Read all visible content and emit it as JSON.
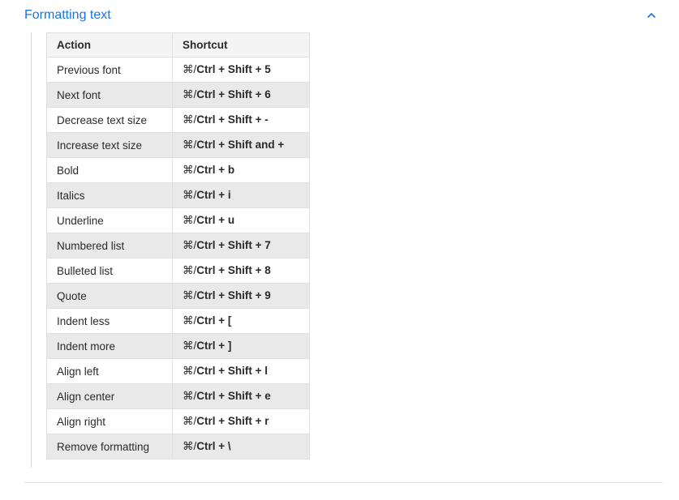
{
  "section": {
    "title": "Formatting text",
    "expanded": true
  },
  "table": {
    "headers": {
      "action": "Action",
      "shortcut": "Shortcut"
    },
    "shortcut_prefix": "⌘/",
    "rows": [
      {
        "action": "Previous font",
        "shortcut_bold": "Ctrl + Shift + 5"
      },
      {
        "action": "Next font",
        "shortcut_bold": "Ctrl + Shift + 6"
      },
      {
        "action": "Decrease text size",
        "shortcut_bold": "Ctrl + Shift + -"
      },
      {
        "action": "Increase text size",
        "shortcut_bold": "Ctrl + Shift and +"
      },
      {
        "action": "Bold",
        "shortcut_bold": "Ctrl + b"
      },
      {
        "action": "Italics",
        "shortcut_bold": "Ctrl + i"
      },
      {
        "action": "Underline",
        "shortcut_bold": "Ctrl + u"
      },
      {
        "action": "Numbered list",
        "shortcut_bold": "Ctrl + Shift + 7"
      },
      {
        "action": "Bulleted list",
        "shortcut_bold": "Ctrl + Shift + 8"
      },
      {
        "action": "Quote",
        "shortcut_bold": "Ctrl + Shift + 9"
      },
      {
        "action": "Indent less",
        "shortcut_bold": "Ctrl + ["
      },
      {
        "action": "Indent more",
        "shortcut_bold": "Ctrl + ]"
      },
      {
        "action": "Align left",
        "shortcut_bold": "Ctrl + Shift + l"
      },
      {
        "action": "Align center",
        "shortcut_bold": "Ctrl + Shift + e"
      },
      {
        "action": "Align right",
        "shortcut_bold": "Ctrl + Shift + r"
      },
      {
        "action": "Remove formatting",
        "shortcut_bold": "Ctrl + \\"
      }
    ]
  }
}
